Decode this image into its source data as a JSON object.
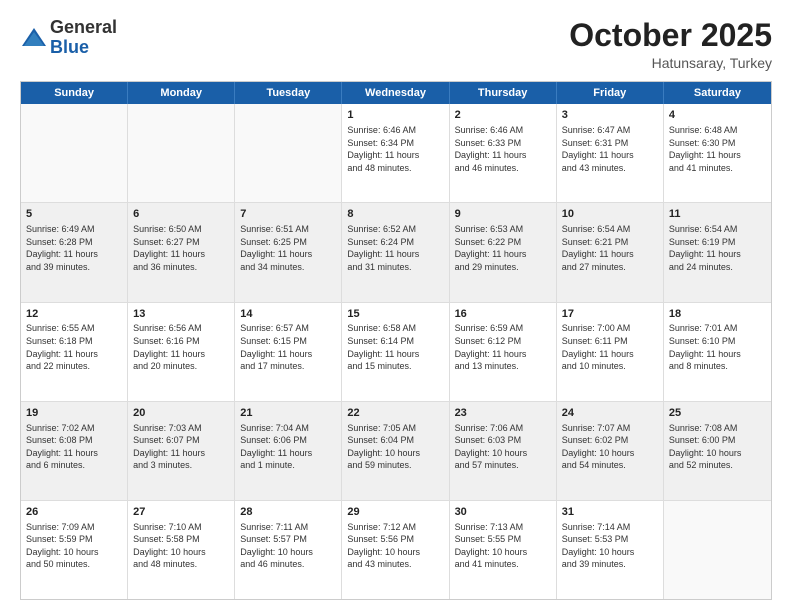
{
  "logo": {
    "general": "General",
    "blue": "Blue"
  },
  "header": {
    "month_year": "October 2025",
    "location": "Hatunsaray, Turkey"
  },
  "weekdays": [
    "Sunday",
    "Monday",
    "Tuesday",
    "Wednesday",
    "Thursday",
    "Friday",
    "Saturday"
  ],
  "rows": [
    [
      {
        "day": "",
        "info": "",
        "empty": true
      },
      {
        "day": "",
        "info": "",
        "empty": true
      },
      {
        "day": "",
        "info": "",
        "empty": true
      },
      {
        "day": "1",
        "info": "Sunrise: 6:46 AM\nSunset: 6:34 PM\nDaylight: 11 hours\nand 48 minutes.",
        "empty": false
      },
      {
        "day": "2",
        "info": "Sunrise: 6:46 AM\nSunset: 6:33 PM\nDaylight: 11 hours\nand 46 minutes.",
        "empty": false
      },
      {
        "day": "3",
        "info": "Sunrise: 6:47 AM\nSunset: 6:31 PM\nDaylight: 11 hours\nand 43 minutes.",
        "empty": false
      },
      {
        "day": "4",
        "info": "Sunrise: 6:48 AM\nSunset: 6:30 PM\nDaylight: 11 hours\nand 41 minutes.",
        "empty": false
      }
    ],
    [
      {
        "day": "5",
        "info": "Sunrise: 6:49 AM\nSunset: 6:28 PM\nDaylight: 11 hours\nand 39 minutes.",
        "shaded": true
      },
      {
        "day": "6",
        "info": "Sunrise: 6:50 AM\nSunset: 6:27 PM\nDaylight: 11 hours\nand 36 minutes.",
        "shaded": true
      },
      {
        "day": "7",
        "info": "Sunrise: 6:51 AM\nSunset: 6:25 PM\nDaylight: 11 hours\nand 34 minutes.",
        "shaded": true
      },
      {
        "day": "8",
        "info": "Sunrise: 6:52 AM\nSunset: 6:24 PM\nDaylight: 11 hours\nand 31 minutes.",
        "shaded": true
      },
      {
        "day": "9",
        "info": "Sunrise: 6:53 AM\nSunset: 6:22 PM\nDaylight: 11 hours\nand 29 minutes.",
        "shaded": true
      },
      {
        "day": "10",
        "info": "Sunrise: 6:54 AM\nSunset: 6:21 PM\nDaylight: 11 hours\nand 27 minutes.",
        "shaded": true
      },
      {
        "day": "11",
        "info": "Sunrise: 6:54 AM\nSunset: 6:19 PM\nDaylight: 11 hours\nand 24 minutes.",
        "shaded": true
      }
    ],
    [
      {
        "day": "12",
        "info": "Sunrise: 6:55 AM\nSunset: 6:18 PM\nDaylight: 11 hours\nand 22 minutes.",
        "empty": false
      },
      {
        "day": "13",
        "info": "Sunrise: 6:56 AM\nSunset: 6:16 PM\nDaylight: 11 hours\nand 20 minutes.",
        "empty": false
      },
      {
        "day": "14",
        "info": "Sunrise: 6:57 AM\nSunset: 6:15 PM\nDaylight: 11 hours\nand 17 minutes.",
        "empty": false
      },
      {
        "day": "15",
        "info": "Sunrise: 6:58 AM\nSunset: 6:14 PM\nDaylight: 11 hours\nand 15 minutes.",
        "empty": false
      },
      {
        "day": "16",
        "info": "Sunrise: 6:59 AM\nSunset: 6:12 PM\nDaylight: 11 hours\nand 13 minutes.",
        "empty": false
      },
      {
        "day": "17",
        "info": "Sunrise: 7:00 AM\nSunset: 6:11 PM\nDaylight: 11 hours\nand 10 minutes.",
        "empty": false
      },
      {
        "day": "18",
        "info": "Sunrise: 7:01 AM\nSunset: 6:10 PM\nDaylight: 11 hours\nand 8 minutes.",
        "empty": false
      }
    ],
    [
      {
        "day": "19",
        "info": "Sunrise: 7:02 AM\nSunset: 6:08 PM\nDaylight: 11 hours\nand 6 minutes.",
        "shaded": true
      },
      {
        "day": "20",
        "info": "Sunrise: 7:03 AM\nSunset: 6:07 PM\nDaylight: 11 hours\nand 3 minutes.",
        "shaded": true
      },
      {
        "day": "21",
        "info": "Sunrise: 7:04 AM\nSunset: 6:06 PM\nDaylight: 11 hours\nand 1 minute.",
        "shaded": true
      },
      {
        "day": "22",
        "info": "Sunrise: 7:05 AM\nSunset: 6:04 PM\nDaylight: 10 hours\nand 59 minutes.",
        "shaded": true
      },
      {
        "day": "23",
        "info": "Sunrise: 7:06 AM\nSunset: 6:03 PM\nDaylight: 10 hours\nand 57 minutes.",
        "shaded": true
      },
      {
        "day": "24",
        "info": "Sunrise: 7:07 AM\nSunset: 6:02 PM\nDaylight: 10 hours\nand 54 minutes.",
        "shaded": true
      },
      {
        "day": "25",
        "info": "Sunrise: 7:08 AM\nSunset: 6:00 PM\nDaylight: 10 hours\nand 52 minutes.",
        "shaded": true
      }
    ],
    [
      {
        "day": "26",
        "info": "Sunrise: 7:09 AM\nSunset: 5:59 PM\nDaylight: 10 hours\nand 50 minutes.",
        "empty": false
      },
      {
        "day": "27",
        "info": "Sunrise: 7:10 AM\nSunset: 5:58 PM\nDaylight: 10 hours\nand 48 minutes.",
        "empty": false
      },
      {
        "day": "28",
        "info": "Sunrise: 7:11 AM\nSunset: 5:57 PM\nDaylight: 10 hours\nand 46 minutes.",
        "empty": false
      },
      {
        "day": "29",
        "info": "Sunrise: 7:12 AM\nSunset: 5:56 PM\nDaylight: 10 hours\nand 43 minutes.",
        "empty": false
      },
      {
        "day": "30",
        "info": "Sunrise: 7:13 AM\nSunset: 5:55 PM\nDaylight: 10 hours\nand 41 minutes.",
        "empty": false
      },
      {
        "day": "31",
        "info": "Sunrise: 7:14 AM\nSunset: 5:53 PM\nDaylight: 10 hours\nand 39 minutes.",
        "empty": false
      },
      {
        "day": "",
        "info": "",
        "empty": true
      }
    ]
  ]
}
